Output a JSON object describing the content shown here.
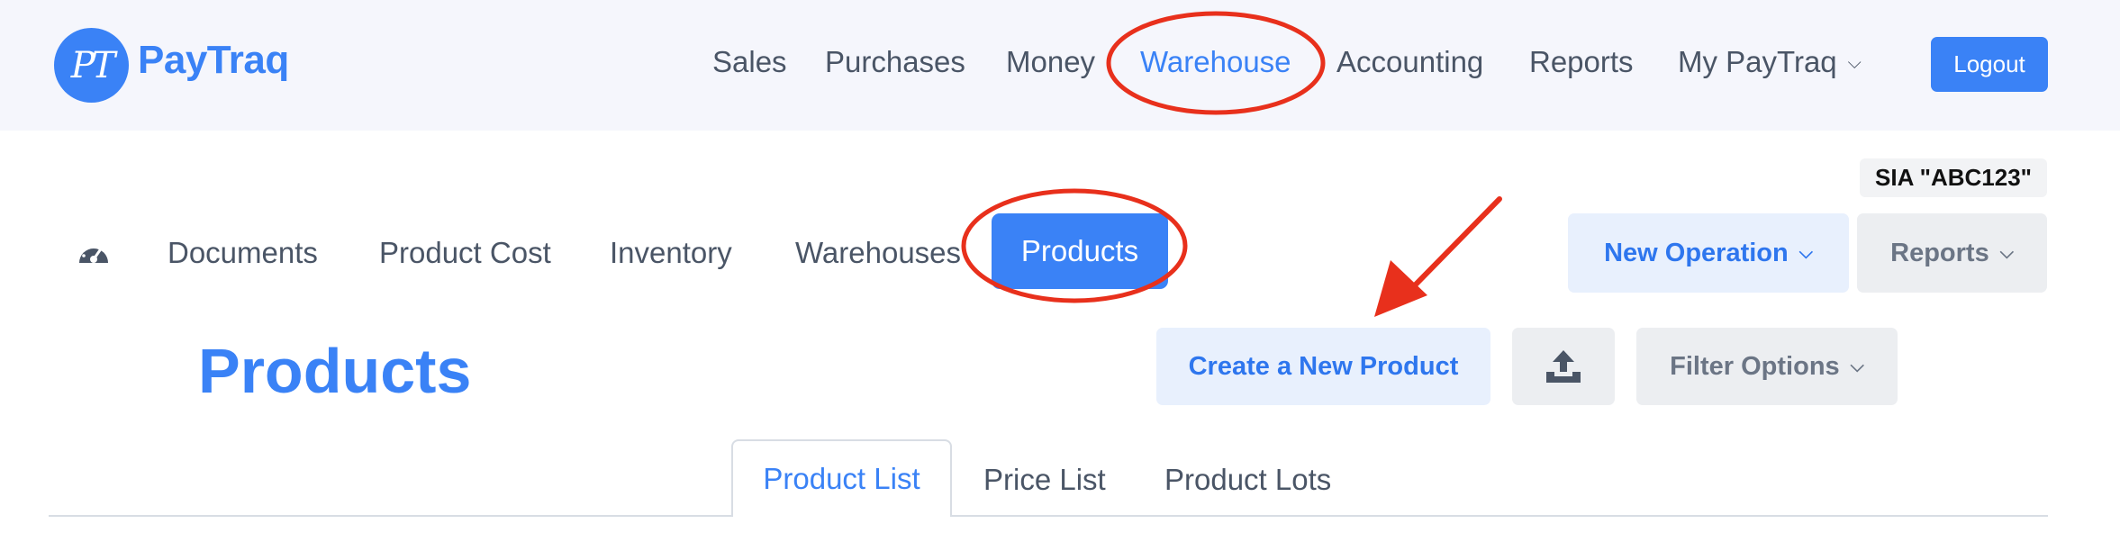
{
  "header": {
    "logo_monogram": "PT",
    "logo_text": "PayTraq",
    "nav": [
      "Sales",
      "Purchases",
      "Money",
      "Warehouse",
      "Accounting",
      "Reports",
      "My PayTraq"
    ],
    "logout_label": "Logout",
    "accent_color": "#3a82f6"
  },
  "company": {
    "name": "SIA \"ABC123\""
  },
  "subnav": {
    "dashboard_icon": "speedometer-icon",
    "items": [
      "Documents",
      "Product Cost",
      "Inventory",
      "Warehouses",
      "Products"
    ],
    "new_operation_label": "New Operation",
    "reports_label": "Reports"
  },
  "page": {
    "title": "Products",
    "create_label": "Create a New Product",
    "upload_icon": "upload-icon",
    "filter_label": "Filter Options"
  },
  "tabs": [
    "Product List",
    "Price List",
    "Product Lots"
  ],
  "annotation_color": "#e8301c"
}
